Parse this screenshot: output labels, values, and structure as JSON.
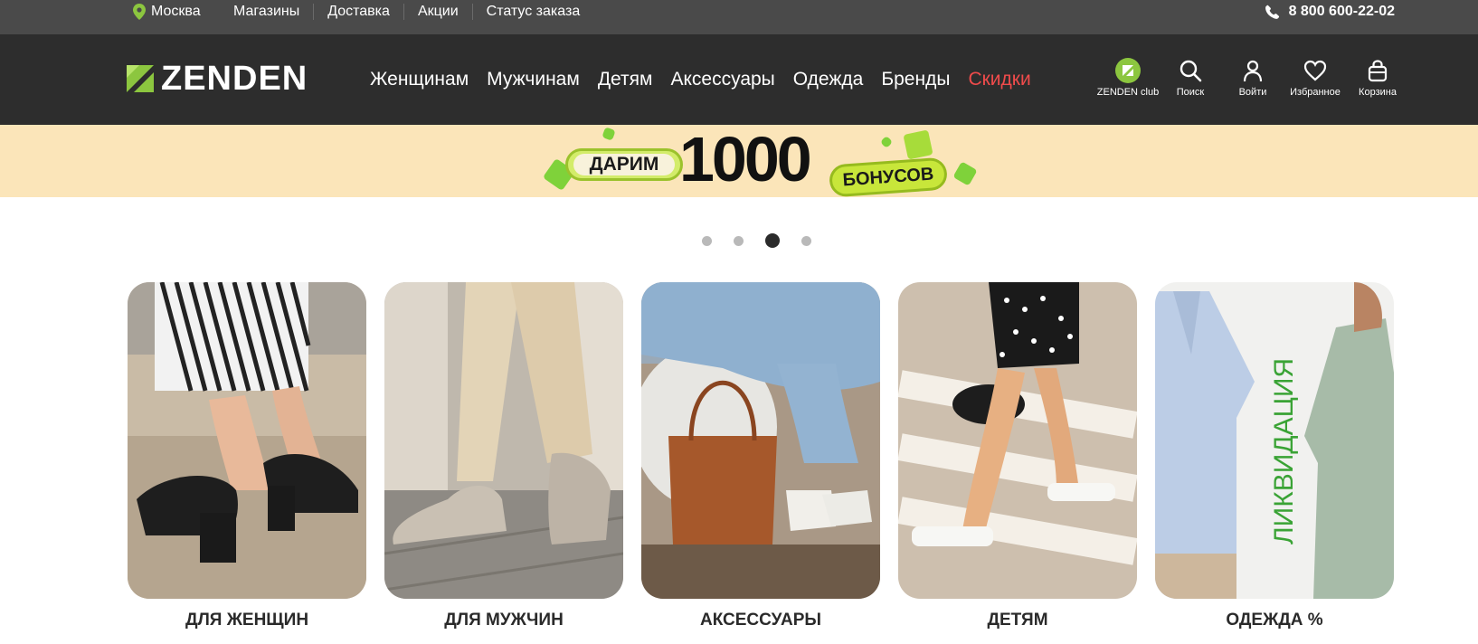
{
  "topbar": {
    "city": "Москва",
    "links": [
      "Магазины",
      "Доставка",
      "Акции",
      "Статус заказа"
    ],
    "phone": "8 800 600-22-02"
  },
  "header": {
    "logo_text": "ZENDEN",
    "nav": [
      "Женщинам",
      "Мужчинам",
      "Детям",
      "Аксессуары",
      "Одежда",
      "Бренды"
    ],
    "sale_label": "Скидки",
    "actions": {
      "club": "ZENDEN club",
      "search": "Поиск",
      "login": "Войти",
      "favorites": "Избранное",
      "cart": "Корзина"
    }
  },
  "banner": {
    "pill_left": "ДАРИМ",
    "amount": "1000",
    "pill_right": "БОНУСОВ"
  },
  "carousel": {
    "slides": 4,
    "active_index": 2
  },
  "categories": [
    {
      "label": "ДЛЯ ЖЕНЩИН"
    },
    {
      "label": "ДЛЯ МУЖЧИН"
    },
    {
      "label": "АКСЕССУАРЫ"
    },
    {
      "label": "ДЕТЯМ"
    },
    {
      "label": "ОДЕЖДА %",
      "overlay": "ЛИКВИДАЦИЯ"
    }
  ],
  "colors": {
    "topbar_bg": "#4a4a4a",
    "header_bg": "#2d2d2d",
    "accent_green": "#8cc63f",
    "sale_red": "#f04b4b",
    "banner_bg": "#fbe5b9"
  }
}
